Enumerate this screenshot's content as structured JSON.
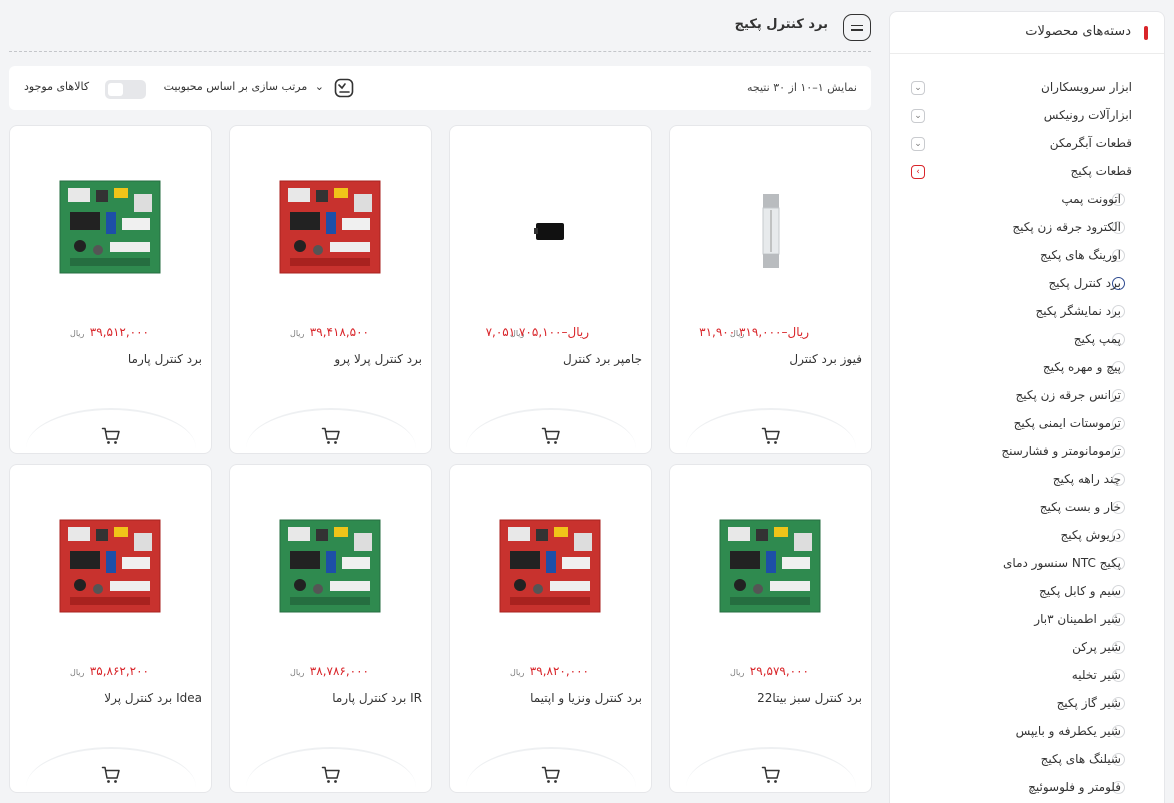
{
  "sidebar": {
    "title": "دسته‌های محصولات",
    "categories": [
      {
        "label": "ابزار سرویسکاران",
        "toggle": "⌄"
      },
      {
        "label": "ابزارآلات رونیکس",
        "toggle": "⌄"
      },
      {
        "label": "قطعات آبگرمکن",
        "toggle": "⌄"
      },
      {
        "label": "قطعات پکیج",
        "toggle": "‹"
      }
    ],
    "sub_items": [
      "اتوونت پمپ",
      "الکترود جرقه زن پکیج",
      "اورینگ های پکیج",
      "برد کنترل پکیج",
      "برد نمایشگر پکیج",
      "پمپ پکیج",
      "پیچ و مهره پکیج",
      "ترانس جرقه زن پکیج",
      "ترموستات ایمنی پکیج",
      "ترمومانومتر و فشارسنج",
      "چند راهه پکیج",
      "خار و بست پکیج",
      "دریوش پکیج",
      "سنسور دمای NTC پکیج",
      "سیم و کابل پکیج",
      "شیر اطمینان ۳بار",
      "شیر پرکن",
      "شیر تخلیه",
      "شیر گاز پکیج",
      "شیر یکطرفه و بایپس",
      "شیلنگ های پکیج",
      "فلومتر و فلوسوئیچ"
    ],
    "selected_index": 3
  },
  "header": {
    "title": "برد کنترل پکیج"
  },
  "toolbar": {
    "result_count": "نمایش ۱–۱۰ از ۳۰ نتیجه",
    "sort_label": "مرتب سازی بر اساس محبوبیت",
    "sort_arrow": "⌄",
    "in_stock_label": "کالاهای موجود",
    "in_stock_on": false
  },
  "products": [
    {
      "name": "برد کنترل پارما",
      "price": "۳۹,۵۱۲,۰۰۰",
      "unit": "ریال",
      "image": "green-pcb-icon"
    },
    {
      "name": "برد کنترل پرلا پرو",
      "price": "۳۹,۴۱۸,۵۰۰",
      "unit": "ریال",
      "image": "red-pcb-icon"
    },
    {
      "name": "جامپر برد کنترل",
      "price": "۷,۰۵۱ ریال–۷۰۵,۱۰۰",
      "unit": "ریال",
      "image": "jumper-icon"
    },
    {
      "name": "فیوز برد کنترل",
      "price": "۳۱,۹۰۰ ریال–۳۱۹,۰۰۰",
      "unit": "ریال",
      "image": "fuse-icon"
    },
    {
      "name": "برد کنترل پرلا Idea",
      "price": "۳۵,۸۶۲,۲۰۰",
      "unit": "ریال",
      "image": "red-pcb-icon"
    },
    {
      "name": "برد کنترل پارما IR",
      "price": "۳۸,۷۸۶,۰۰۰",
      "unit": "ریال",
      "image": "green-pcb-icon"
    },
    {
      "name": "برد کنترل ونزیا و اپتیما",
      "price": "۳۹,۸۲۰,۰۰۰",
      "unit": "ریال",
      "image": "red-pcb-icon"
    },
    {
      "name": "برد کنترل سبز بیتا22",
      "price": "۲۹,۵۷۹,۰۰۰",
      "unit": "ریال",
      "image": "green-pcb-icon"
    }
  ],
  "colors": {
    "accent": "#d9252a",
    "selected": "#2e4a8f",
    "background": "#f3f4f6"
  }
}
